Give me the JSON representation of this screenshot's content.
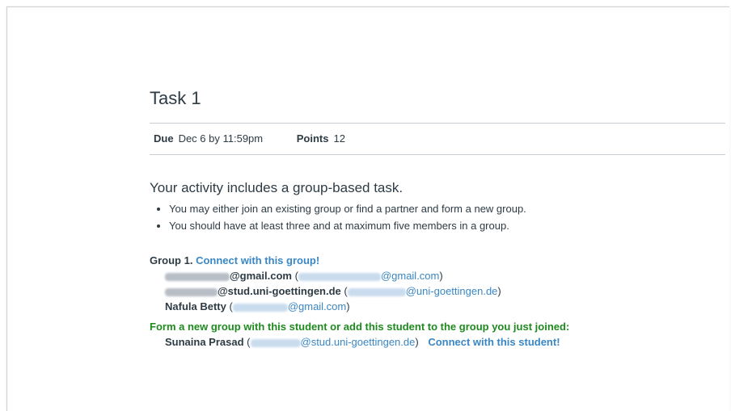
{
  "task": {
    "title": "Task 1",
    "due_label": "Due",
    "due_value": "Dec 6 by 11:59pm",
    "points_label": "Points",
    "points_value": "12"
  },
  "activity": {
    "heading": "Your activity includes a group-based task.",
    "bullets": [
      "You may either join an existing group or find a partner and form a new group.",
      "You should have at least three and at maximum five members in a group."
    ]
  },
  "group": {
    "label": "Group 1.",
    "connect_link": "Connect with this group!",
    "members": [
      {
        "name_suffix": "@gmail.com",
        "email_suffix": "@gmail.com"
      },
      {
        "name_suffix": "@stud.uni-goettingen.de",
        "email_suffix": "@uni-goettingen.de"
      },
      {
        "name": "Nafula Betty",
        "email_suffix": "@gmail.com"
      }
    ]
  },
  "new_group": {
    "prompt": "Form a new group with this student or add this student to the group you just joined:",
    "student_name": "Sunaina Prasad",
    "student_email_suffix": "@stud.uni-goettingen.de",
    "connect_link": "Connect with this student!"
  },
  "colors": {
    "link": "#3a87c4",
    "green": "#1e8a1e",
    "text": "#2d3b45"
  }
}
